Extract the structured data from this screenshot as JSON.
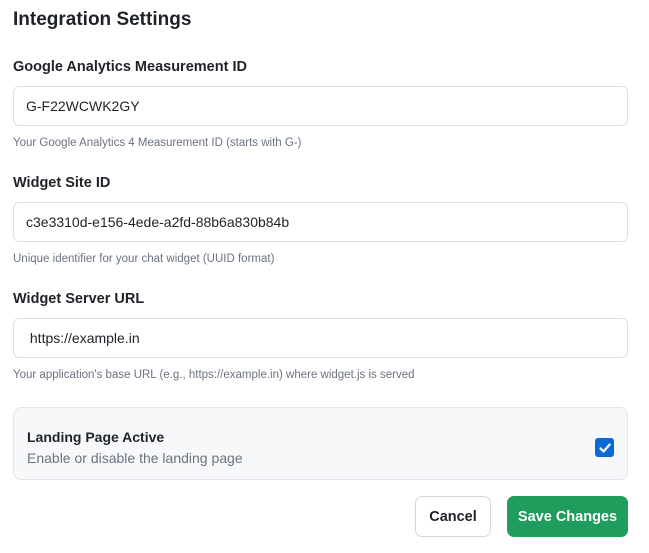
{
  "page": {
    "title": "Integration Settings"
  },
  "fields": {
    "ga": {
      "label": "Google Analytics Measurement ID",
      "value": "G-F22WCWK2GY",
      "help": "Your Google Analytics 4 Measurement ID (starts with G-)"
    },
    "widget_site": {
      "label": "Widget Site ID",
      "value": "c3e3310d-e156-4ede-a2fd-88b6a830b84b",
      "help": "Unique identifier for your chat widget (UUID format)"
    },
    "widget_server": {
      "label": "Widget Server URL",
      "value": " https://example.in",
      "help": "Your application's base URL (e.g., https://example.in) where widget.js is served"
    }
  },
  "landing_toggle": {
    "title": "Landing Page Active",
    "subtitle": "Enable or disable the landing page",
    "checked": true,
    "checkbox_color": "#0a6bd6",
    "icon": "checkmark-icon"
  },
  "actions": {
    "cancel_label": "Cancel",
    "save_label": "Save Changes",
    "save_color": "#1f9d5c"
  }
}
